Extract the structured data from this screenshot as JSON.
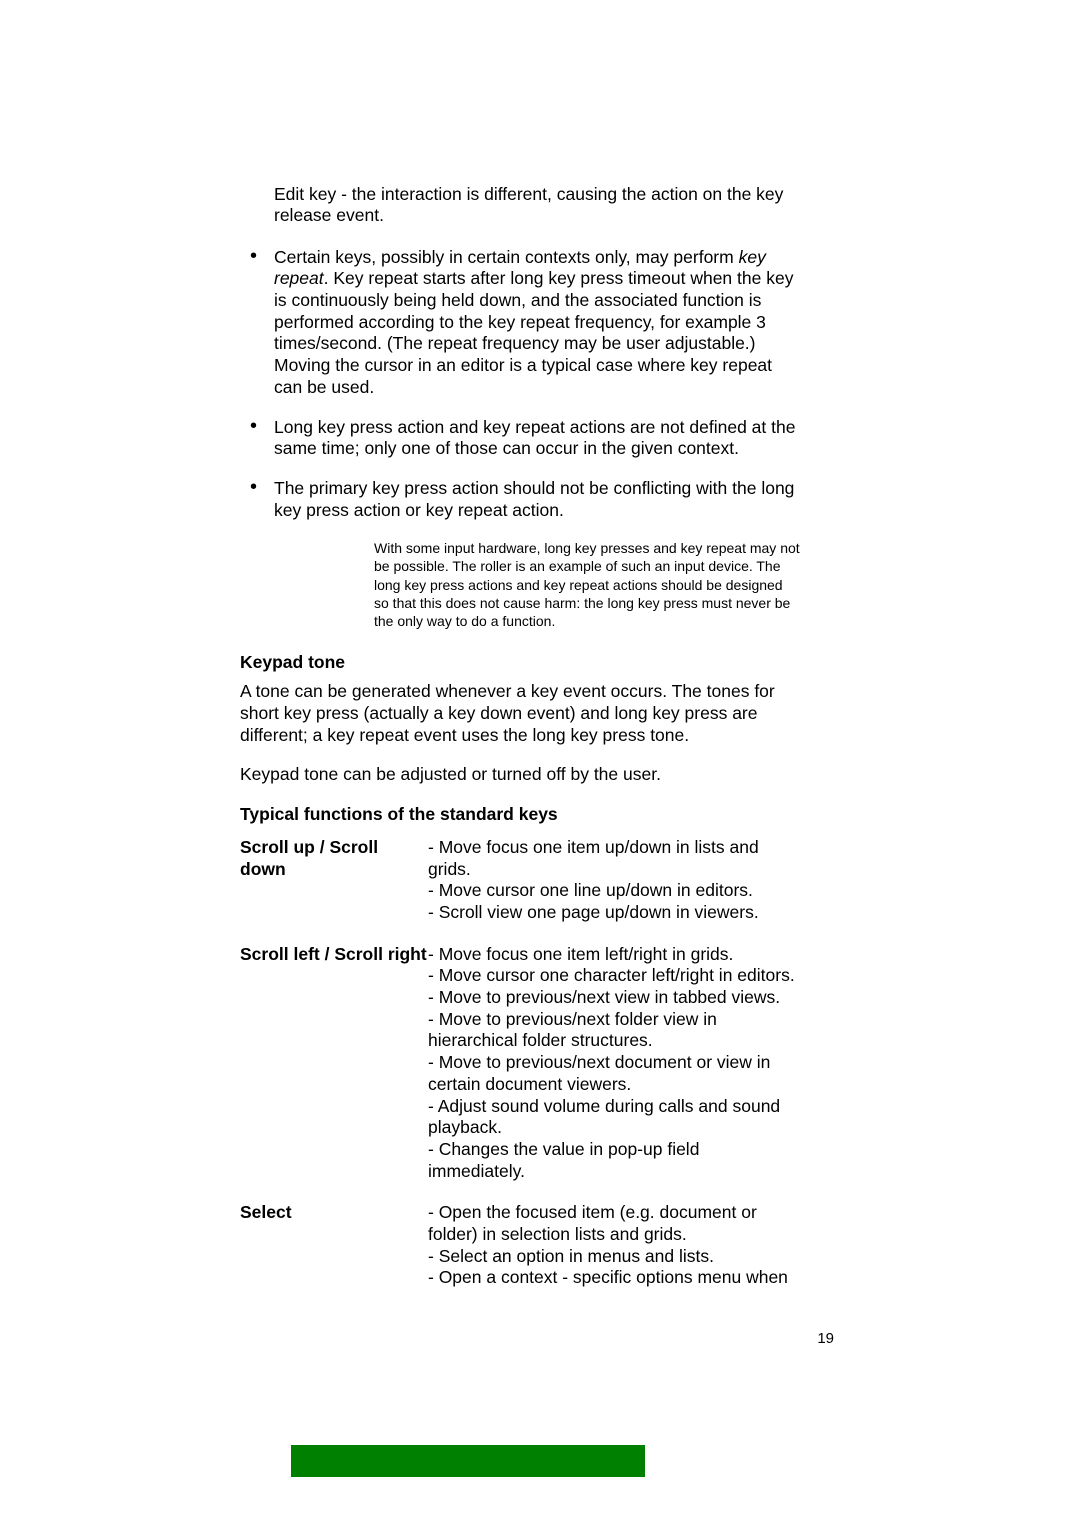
{
  "intro_paragraph": "Edit key - the interaction is different, causing the action on the key release event.",
  "bullets": [
    {
      "pre": "Certain keys, possibly in certain contexts only, may perform ",
      "italic": "key repeat",
      "post": ". Key repeat starts after long key press timeout when the key is continuously being held down, and the associated function is performed according to the key repeat frequency, for example 3 times/second. (The repeat frequency may be user adjustable.) Moving the cursor in an editor is a typical case where key repeat can be used."
    },
    {
      "text": "Long key press action and key repeat actions are not defined at the same time; only one of those can occur in the given context."
    },
    {
      "text": "The primary key press action should not be conflicting with the long key press action or key repeat action."
    }
  ],
  "note": "With some input hardware, long key presses and key repeat may not be possible. The roller is an example of such an input device. The long key press actions and key repeat actions should be designed so that this does not cause harm: the long key press must never be the only way to do a function.",
  "section_keypad_tone": {
    "heading": "Keypad tone",
    "p1": "A tone can be generated whenever a key event occurs. The tones for short key press (actually a key down event) and long key press are different; a key repeat event uses the long key press tone.",
    "p2": "Keypad tone can be adjusted or turned off by the user."
  },
  "section_functions": {
    "heading": "Typical functions of the standard keys",
    "rows": [
      {
        "term": "Scroll up / Scroll down",
        "desc": "- Move focus one item up/down in lists and grids.\n- Move cursor one line up/down in editors.\n- Scroll view one page up/down in viewers."
      },
      {
        "term": "Scroll left / Scroll right",
        "desc": "- Move focus one item left/right in grids.\n- Move cursor one character left/right in editors.\n- Move to previous/next view in tabbed views.\n- Move to previous/next folder view in hierarchical folder structures.\n- Move to previous/next document or view in certain document viewers.\n- Adjust sound volume during calls and sound playback.\n- Changes the value in pop-up field immediately."
      },
      {
        "term": "Select",
        "desc": "- Open the focused item (e.g. document or folder) in selection lists and grids.\n- Select an option in menus and lists.\n- Open a context - specific options menu when"
      }
    ]
  },
  "page_number": "19"
}
